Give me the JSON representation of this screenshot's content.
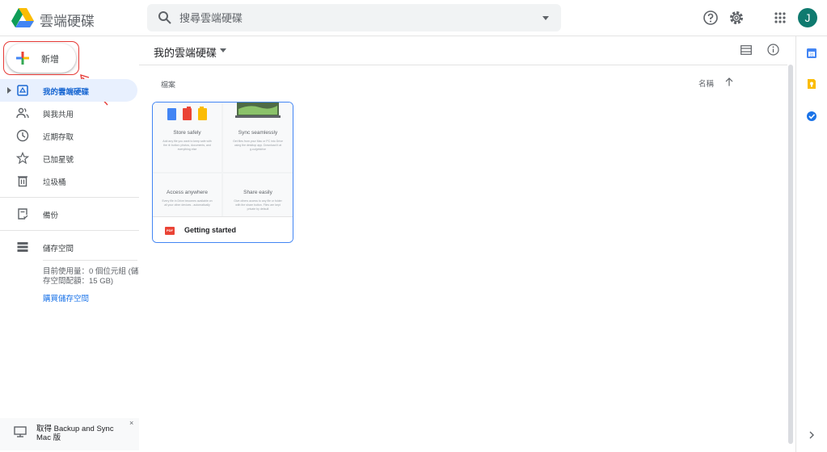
{
  "header": {
    "app_title": "雲端硬碟",
    "search_placeholder": "搜尋雲端硬碟",
    "avatar_initial": "J"
  },
  "new_button": {
    "label": "新增"
  },
  "sidebar": {
    "items": [
      {
        "label": "我的雲端硬碟",
        "icon": "my-drive-icon",
        "active": true
      },
      {
        "label": "與我共用",
        "icon": "shared-people-icon",
        "active": false
      },
      {
        "label": "近期存取",
        "icon": "clock-icon",
        "active": false
      },
      {
        "label": "已加星號",
        "icon": "star-icon",
        "active": false
      },
      {
        "label": "垃圾桶",
        "icon": "trash-icon",
        "active": false
      },
      {
        "label": "備份",
        "icon": "backup-icon",
        "active": false
      },
      {
        "label": "儲存空間",
        "icon": "storage-icon",
        "active": false
      }
    ],
    "storage_usage_line1": "目前使用量：0 個位元組 (儲",
    "storage_usage_line2": "存空間配額：15 GB)",
    "buy_storage": "購買儲存空間",
    "sync_banner": "取得 Backup and Sync Mac 版",
    "sync_close": "×"
  },
  "main": {
    "title": "我的雲端硬碟",
    "files_label": "檔案",
    "sort_label": "名稱",
    "files": [
      {
        "name": "Getting started",
        "type_badge": "PDF",
        "tiles": [
          {
            "title": "Store safely",
            "text": "Add any file you want to keep safe with the ⊕ button: photos, documents, and everything else"
          },
          {
            "title": "Sync seamlessly",
            "text": "Get files from your Mac or PC into Drive using the desktop app. Download it at g.co/getdrive"
          },
          {
            "title": "Access anywhere",
            "text": "Every file in Drive becomes available on all your other devices - automatically"
          },
          {
            "title": "Share easily",
            "text": "Give others access to any file or folder with the share button. Files are kept private by default"
          }
        ]
      }
    ]
  },
  "colors": {
    "accent": "#1a73e8",
    "active_bg": "#e8f0fe",
    "annotation": "#e53935"
  }
}
